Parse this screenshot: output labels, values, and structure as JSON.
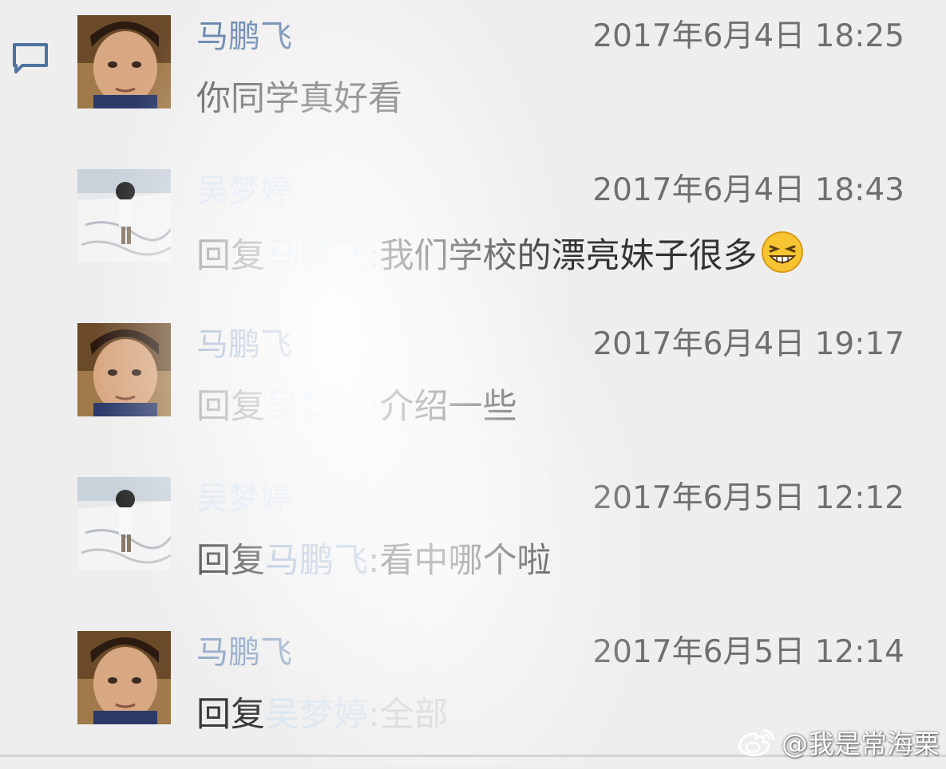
{
  "comments": [
    {
      "author": "马鹏飞",
      "time": "2017年6月4日 18:25",
      "text": "你同学真好看"
    },
    {
      "author": "吴梦婷",
      "time": "2017年6月4日 18:43",
      "reply_word": "回复",
      "reply_to": "马鹏飞",
      "colon": ":",
      "text": "我们学校的漂亮妹子很多",
      "emoji": "grinning-squint-emoji"
    },
    {
      "author": "马鹏飞",
      "time": "2017年6月4日 19:17",
      "reply_word": "回复",
      "reply_to": "吴梦婷",
      "colon": ":",
      "text": "介绍一些"
    },
    {
      "author": "吴梦婷",
      "time": "2017年6月5日 12:12",
      "reply_word": "回复",
      "reply_to": "马鹏飞",
      "colon": ":",
      "text": "看中哪个啦"
    },
    {
      "author": "马鹏飞",
      "time": "2017年6月5日 12:14",
      "reply_word": "回复",
      "reply_to": "吴梦婷",
      "colon": ":",
      "text": "全部"
    }
  ],
  "icons": {
    "comment": "comment-bubble-icon",
    "watermark": "weibo-logo-icon"
  },
  "watermark": {
    "text": "@我是常海栗"
  },
  "colors": {
    "author_name": "#5b7ba8",
    "timestamp": "#6f6f6f",
    "message_text": "#333333",
    "background": "#eeeeee"
  }
}
